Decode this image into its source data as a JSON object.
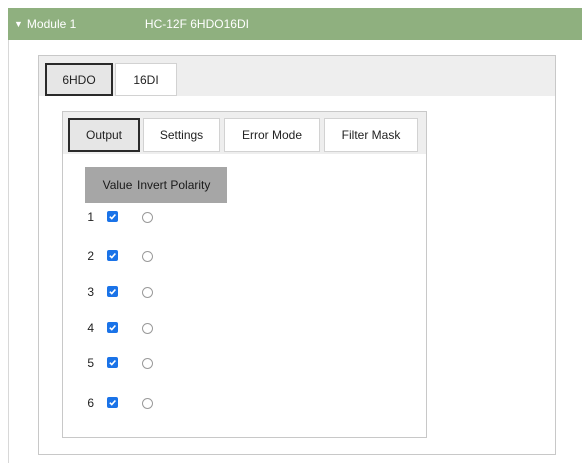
{
  "module": {
    "name": "Module 1",
    "model": "HC-12F 6HDO16DI"
  },
  "outer_tabs": [
    "6HDO",
    "16DI"
  ],
  "inner_tabs": [
    "Output",
    "Settings",
    "Error Mode",
    "Filter Mask"
  ],
  "table": {
    "columns": [
      "Value",
      "Invert Polarity"
    ],
    "rows": [
      {
        "num": "1",
        "value": true,
        "invert": false
      },
      {
        "num": "2",
        "value": true,
        "invert": false
      },
      {
        "num": "3",
        "value": true,
        "invert": false
      },
      {
        "num": "4",
        "value": true,
        "invert": false
      },
      {
        "num": "5",
        "value": true,
        "invert": false
      },
      {
        "num": "6",
        "value": true,
        "invert": false
      }
    ]
  },
  "colors": {
    "header_green": "#8fb07f",
    "checkbox_blue": "#1a73e8",
    "table_header_gray": "#a6a6a6"
  }
}
